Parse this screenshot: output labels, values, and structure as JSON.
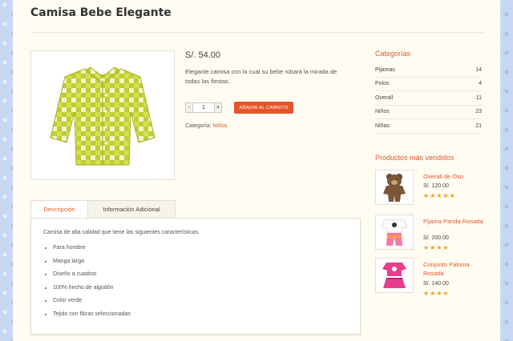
{
  "product": {
    "title": "Camisa Bebe Elegante",
    "price": "S/. 54.00",
    "short_description": "Elegante camisa con la cual su bebe robará la mirada de todas las fiestas.",
    "quantity": "1",
    "qty_minus": "-",
    "qty_plus": "+",
    "add_to_cart": "AÑADIR AL CARRITO",
    "category_label": "Categoría:",
    "category_value": "Niños",
    "image_icon": "plaid-shirt-image"
  },
  "tabs": [
    {
      "label": "Descripción",
      "active": true
    },
    {
      "label": "Información Adicional",
      "active": false
    }
  ],
  "description": {
    "intro": "Camisa de alta calidad que tiene las siguientes características.",
    "features": [
      "Para hombre",
      "Manga larga",
      "Diseño a cuadros",
      "100% hecho de algodón",
      "Color verde",
      "Tejido con fibras seleccionadas"
    ]
  },
  "sidebar": {
    "categories_title": "Categorías",
    "categories": [
      {
        "name": "Pijamas",
        "count": "14"
      },
      {
        "name": "Polos",
        "count": "4"
      },
      {
        "name": "Overall",
        "count": "11"
      },
      {
        "name": "Niños",
        "count": "23"
      },
      {
        "name": "Niñas",
        "count": "21"
      }
    ],
    "best_title": "Productos más vendidos",
    "best_sellers": [
      {
        "name": "Overall de Oso",
        "price": "S/. 120.00",
        "stars": "★★★★★",
        "icon": "bear-overall-image"
      },
      {
        "name": "Pijama Panda Rosada",
        "price": "S/. 200.00",
        "stars": "★★★★",
        "icon": "panda-pajama-image"
      },
      {
        "name": "Conjunto Paloma Rosada",
        "price": "S/. 140.00",
        "stars": "★★★★",
        "icon": "pink-outfit-image"
      }
    ]
  },
  "colors": {
    "accent": "#e4562a",
    "page_bg": "#fffcf2",
    "outer_bg": "#c8d8f3",
    "stars": "#f0a020"
  }
}
